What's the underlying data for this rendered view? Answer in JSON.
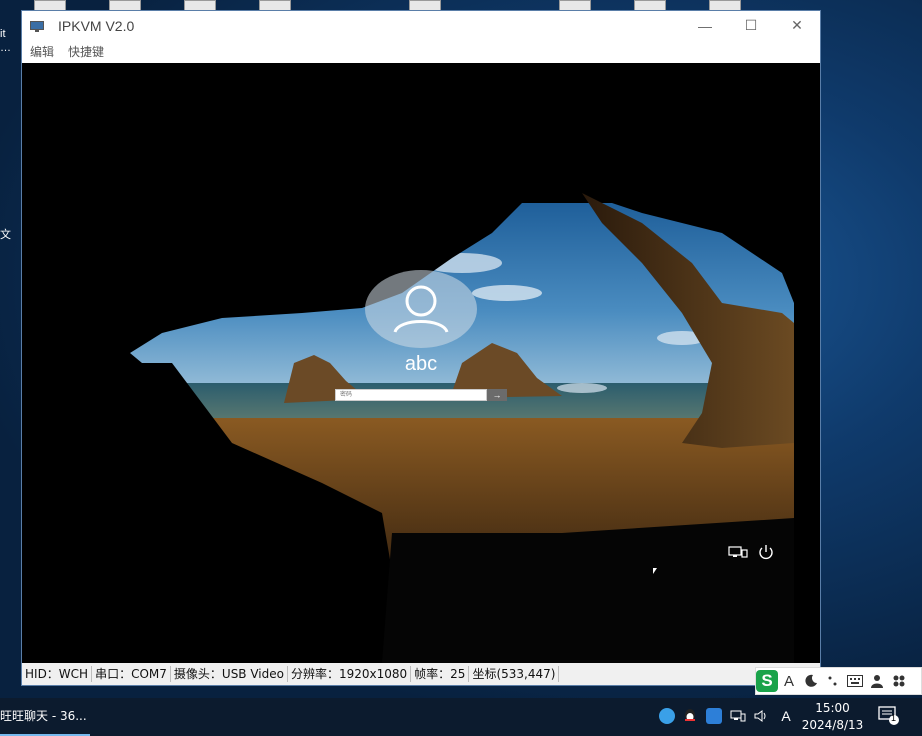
{
  "window": {
    "title": "IPKVM V2.0",
    "minimize_glyph": "—",
    "maximize_glyph": "☐",
    "close_glyph": "✕"
  },
  "menu": {
    "items": [
      "编辑",
      "快捷键"
    ]
  },
  "login": {
    "user_name": "abc",
    "password_placeholder": "密码",
    "submit_glyph": "→",
    "icons": [
      "user-avatar-icon",
      "network-icon",
      "power-icon"
    ]
  },
  "status": {
    "hid": "HID：WCH",
    "serial": "串口：COM7",
    "camera": "摄像头：USB Video",
    "resolution": "分辨率：1920x1080",
    "framerate": "帧率：25",
    "coords": "坐标(533,447)"
  },
  "ime": {
    "logo": "S",
    "mode": "A",
    "items": [
      "sogou-logo-icon",
      "letter-mode-icon",
      "moon-icon",
      "punctuation-icon",
      "keyboard-icon",
      "user-icon",
      "grid-icon"
    ]
  },
  "taskbar": {
    "active_app": "旺旺聊天 - 36...",
    "tray_input_mode": "A",
    "time": "15:00",
    "date": "2024/8/13",
    "notification_count": "1"
  },
  "desktop": {
    "edge_text_1": "it",
    "edge_text_2": "…",
    "edge_text_3": "文"
  },
  "colors": {
    "titlebar": "#ffffff",
    "taskbar": "#0c1b2e",
    "accent": "#76b9ed",
    "desktop": "#0f3a6b"
  }
}
